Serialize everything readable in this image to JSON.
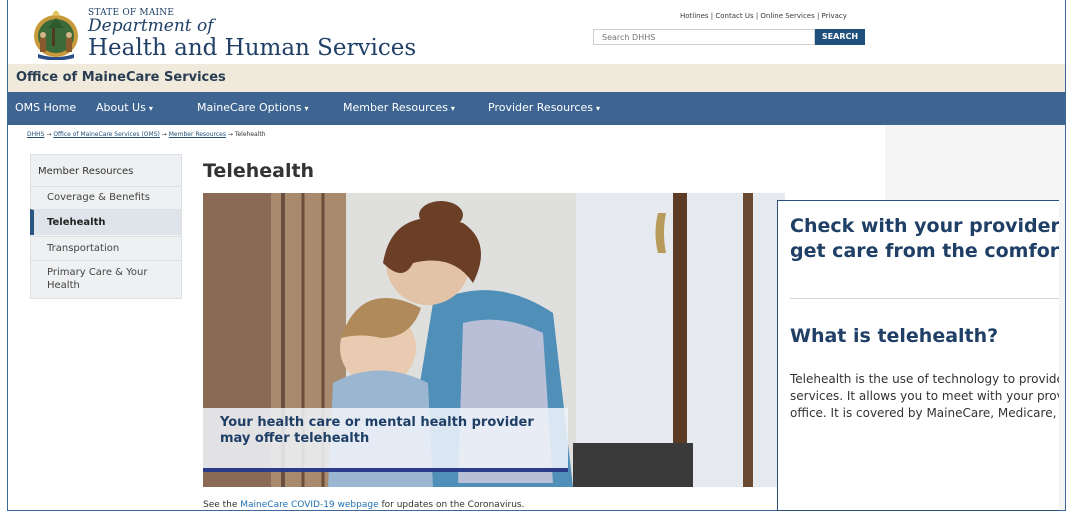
{
  "header": {
    "state_label": "STATE OF MAINE",
    "dept_label": "Department of",
    "agency_label": "Health and Human Services",
    "top_links": "Hotlines | Contact Us | Online Services | Privacy",
    "search": {
      "placeholder": "Search DHHS",
      "button_label": "SEARCH"
    }
  },
  "office": {
    "title": "Office of MaineCare Services"
  },
  "nav": {
    "items": [
      {
        "label": "OMS Home",
        "has_dropdown": false
      },
      {
        "label": "About Us",
        "has_dropdown": true
      },
      {
        "label": "MaineCare Options",
        "has_dropdown": true
      },
      {
        "label": "Member Resources",
        "has_dropdown": true
      },
      {
        "label": "Provider Resources",
        "has_dropdown": true
      }
    ],
    "caret": "▾"
  },
  "breadcrumb": {
    "items": [
      "DHHS",
      "Office of MaineCare Services (OMS)",
      "Member Resources"
    ],
    "current": "Telehealth",
    "separator": "→"
  },
  "sidebar": {
    "heading": "Member Resources",
    "items": [
      {
        "label": "Coverage & Benefits",
        "active": false
      },
      {
        "label": "Telehealth",
        "active": true
      },
      {
        "label": "Transportation",
        "active": false
      },
      {
        "label": "Primary Care & Your Health",
        "active": false
      }
    ]
  },
  "main": {
    "title": "Telehealth",
    "hero_caption": "Your health care or mental health provider may offer telehealth",
    "covid_note": {
      "prefix": "See the ",
      "link": "MaineCare COVID-19 webpage",
      "suffix": " for updates on the Coronavirus."
    }
  },
  "callout": {
    "headline": "Check with your provider to see how you can get care from the comfort of your own home.",
    "subheading": "What is telehealth?",
    "body": "Telehealth is the use of technology to provide health care appointments and services. It allows you to meet with your provider without having to go to their office. It is covered by MaineCare, Medicare, and most private insurance."
  },
  "colors": {
    "brand_blue": "#1f3f66",
    "nav_blue": "#3e6591",
    "office_bar": "#efeadb"
  }
}
